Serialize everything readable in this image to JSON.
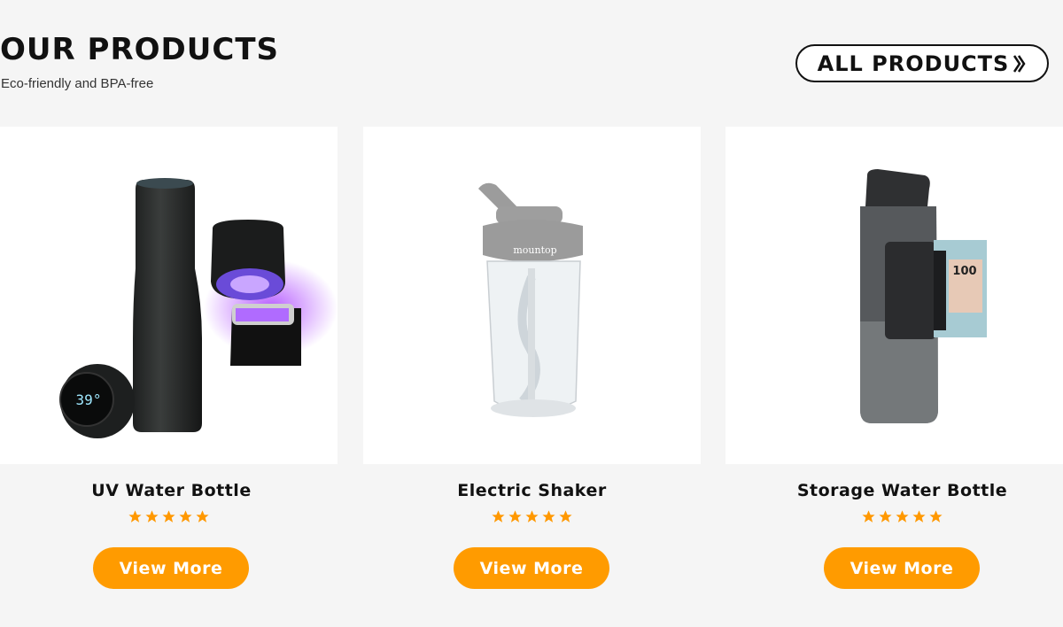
{
  "section": {
    "title": "OUR PRODUCTS",
    "subtitle": "Eco-friendly and BPA-free"
  },
  "all_products_label": "ALL PRODUCTS",
  "colors": {
    "accent": "#ff9b00",
    "star": "#ff9800",
    "background": "#f5f5f5"
  },
  "products": [
    {
      "name": "UV Water Bottle",
      "rating": 5,
      "button": "View More",
      "image_icon": "uv-water-bottle-image",
      "display_text": "39°"
    },
    {
      "name": "Electric Shaker",
      "rating": 5,
      "button": "View More",
      "image_icon": "electric-shaker-image",
      "brand_text": "mountop"
    },
    {
      "name": "Storage Water Bottle",
      "rating": 5,
      "button": "View More",
      "image_icon": "storage-water-bottle-image",
      "card_text": "100"
    }
  ]
}
